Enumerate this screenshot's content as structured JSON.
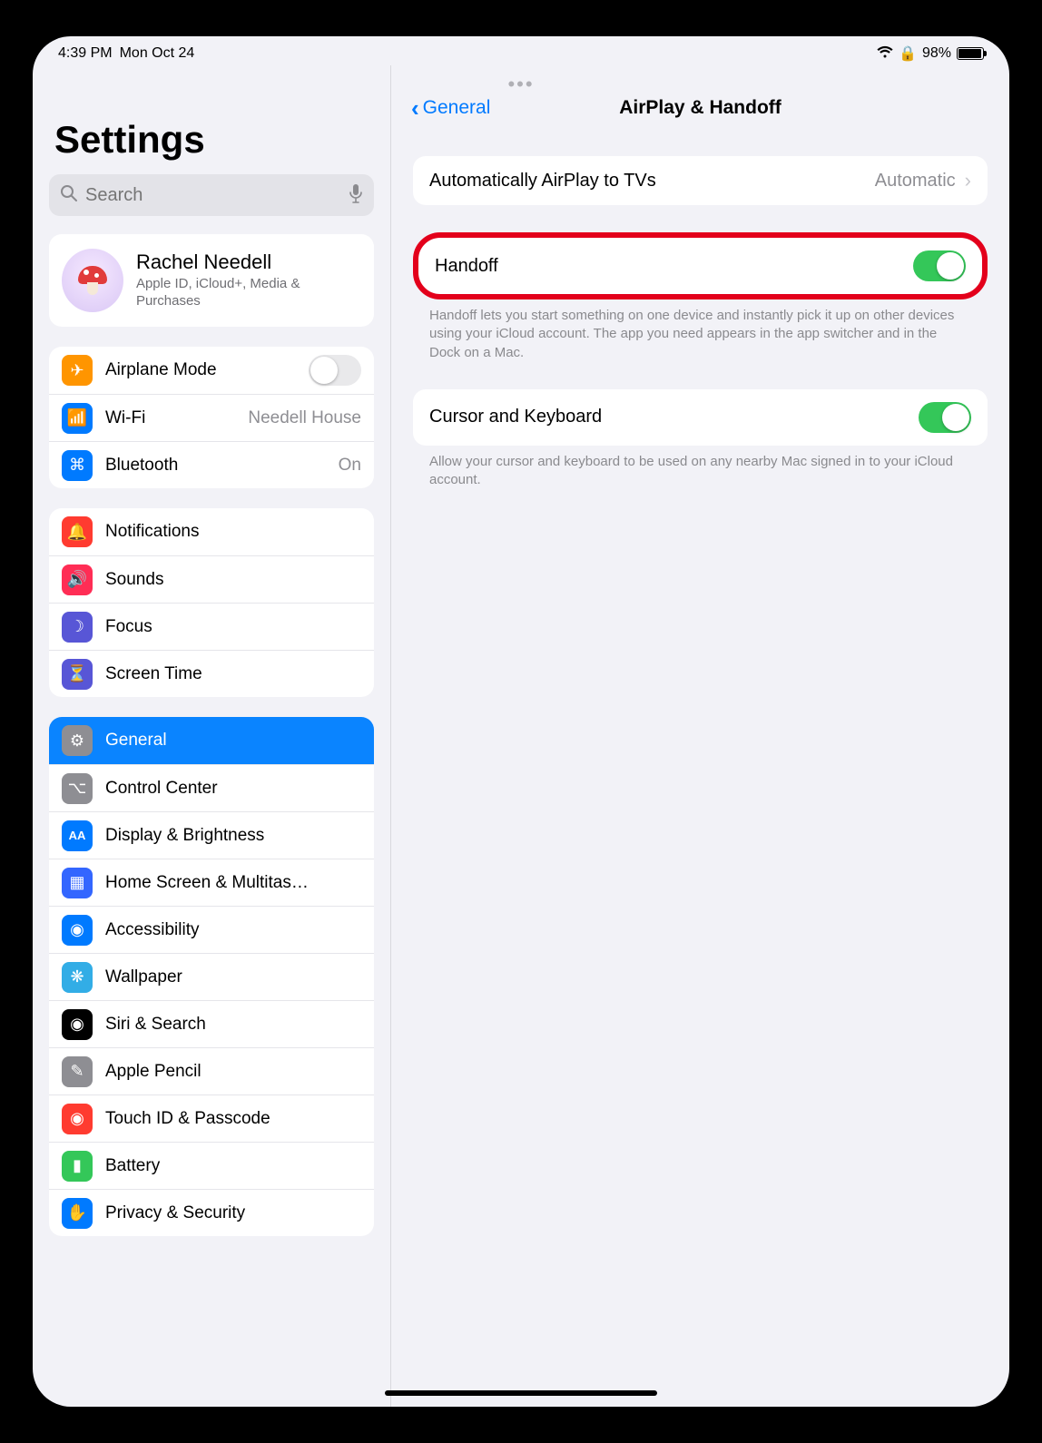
{
  "status": {
    "time": "4:39 PM",
    "date": "Mon Oct 24",
    "battery_pct": "98%"
  },
  "sidebar": {
    "title": "Settings",
    "search_placeholder": "Search",
    "apple_id": {
      "name": "Rachel Needell",
      "subtitle": "Apple ID, iCloud+, Media & Purchases"
    },
    "group1": [
      {
        "label": "Airplane Mode",
        "value": "",
        "toggle": false,
        "icon": "airplane",
        "bg": "bg-orange",
        "glyph": "✈"
      },
      {
        "label": "Wi-Fi",
        "value": "Needell House",
        "icon": "wifi",
        "bg": "bg-blue",
        "glyph": "📶"
      },
      {
        "label": "Bluetooth",
        "value": "On",
        "icon": "bluetooth",
        "bg": "bg-blue",
        "glyph": "⌘"
      }
    ],
    "group2": [
      {
        "label": "Notifications",
        "icon": "bell",
        "bg": "bg-red",
        "glyph": "🔔"
      },
      {
        "label": "Sounds",
        "icon": "speaker",
        "bg": "bg-red2",
        "glyph": "🔊"
      },
      {
        "label": "Focus",
        "icon": "moon",
        "bg": "bg-indigo",
        "glyph": "☽"
      },
      {
        "label": "Screen Time",
        "icon": "hourglass",
        "bg": "bg-indigo",
        "glyph": "⏳"
      }
    ],
    "group3": [
      {
        "label": "General",
        "icon": "gear",
        "bg": "bg-gray",
        "glyph": "⚙",
        "selected": true
      },
      {
        "label": "Control Center",
        "icon": "switches",
        "bg": "bg-gray",
        "glyph": "⌥"
      },
      {
        "label": "Display & Brightness",
        "icon": "AA",
        "bg": "bg-blue",
        "glyph": "AA"
      },
      {
        "label": "Home Screen & Multitas…",
        "icon": "grid",
        "bg": "bg-darkblue",
        "glyph": "▦"
      },
      {
        "label": "Accessibility",
        "icon": "person",
        "bg": "bg-blue",
        "glyph": "◉"
      },
      {
        "label": "Wallpaper",
        "icon": "flower",
        "bg": "bg-cyan",
        "glyph": "❋"
      },
      {
        "label": "Siri & Search",
        "icon": "siri",
        "bg": "bg-black",
        "glyph": "◉"
      },
      {
        "label": "Apple Pencil",
        "icon": "pencil",
        "bg": "bg-gray",
        "glyph": "✎"
      },
      {
        "label": "Touch ID & Passcode",
        "icon": "fingerprint",
        "bg": "bg-red",
        "glyph": "◉"
      },
      {
        "label": "Battery",
        "icon": "battery",
        "bg": "bg-green",
        "glyph": "▮"
      },
      {
        "label": "Privacy & Security",
        "icon": "hand",
        "bg": "bg-bluehand",
        "glyph": "✋"
      }
    ]
  },
  "detail": {
    "back_label": "General",
    "title": "AirPlay & Handoff",
    "rows": {
      "auto_airplay": {
        "label": "Automatically AirPlay to TVs",
        "value": "Automatic"
      },
      "handoff": {
        "label": "Handoff"
      },
      "handoff_note": "Handoff lets you start something on one device and instantly pick it up on other devices using your iCloud account. The app you need appears in the app switcher and in the Dock on a Mac.",
      "cursor": {
        "label": "Cursor and Keyboard"
      },
      "cursor_note": "Allow your cursor and keyboard to be used on any nearby Mac signed in to your iCloud account."
    }
  }
}
